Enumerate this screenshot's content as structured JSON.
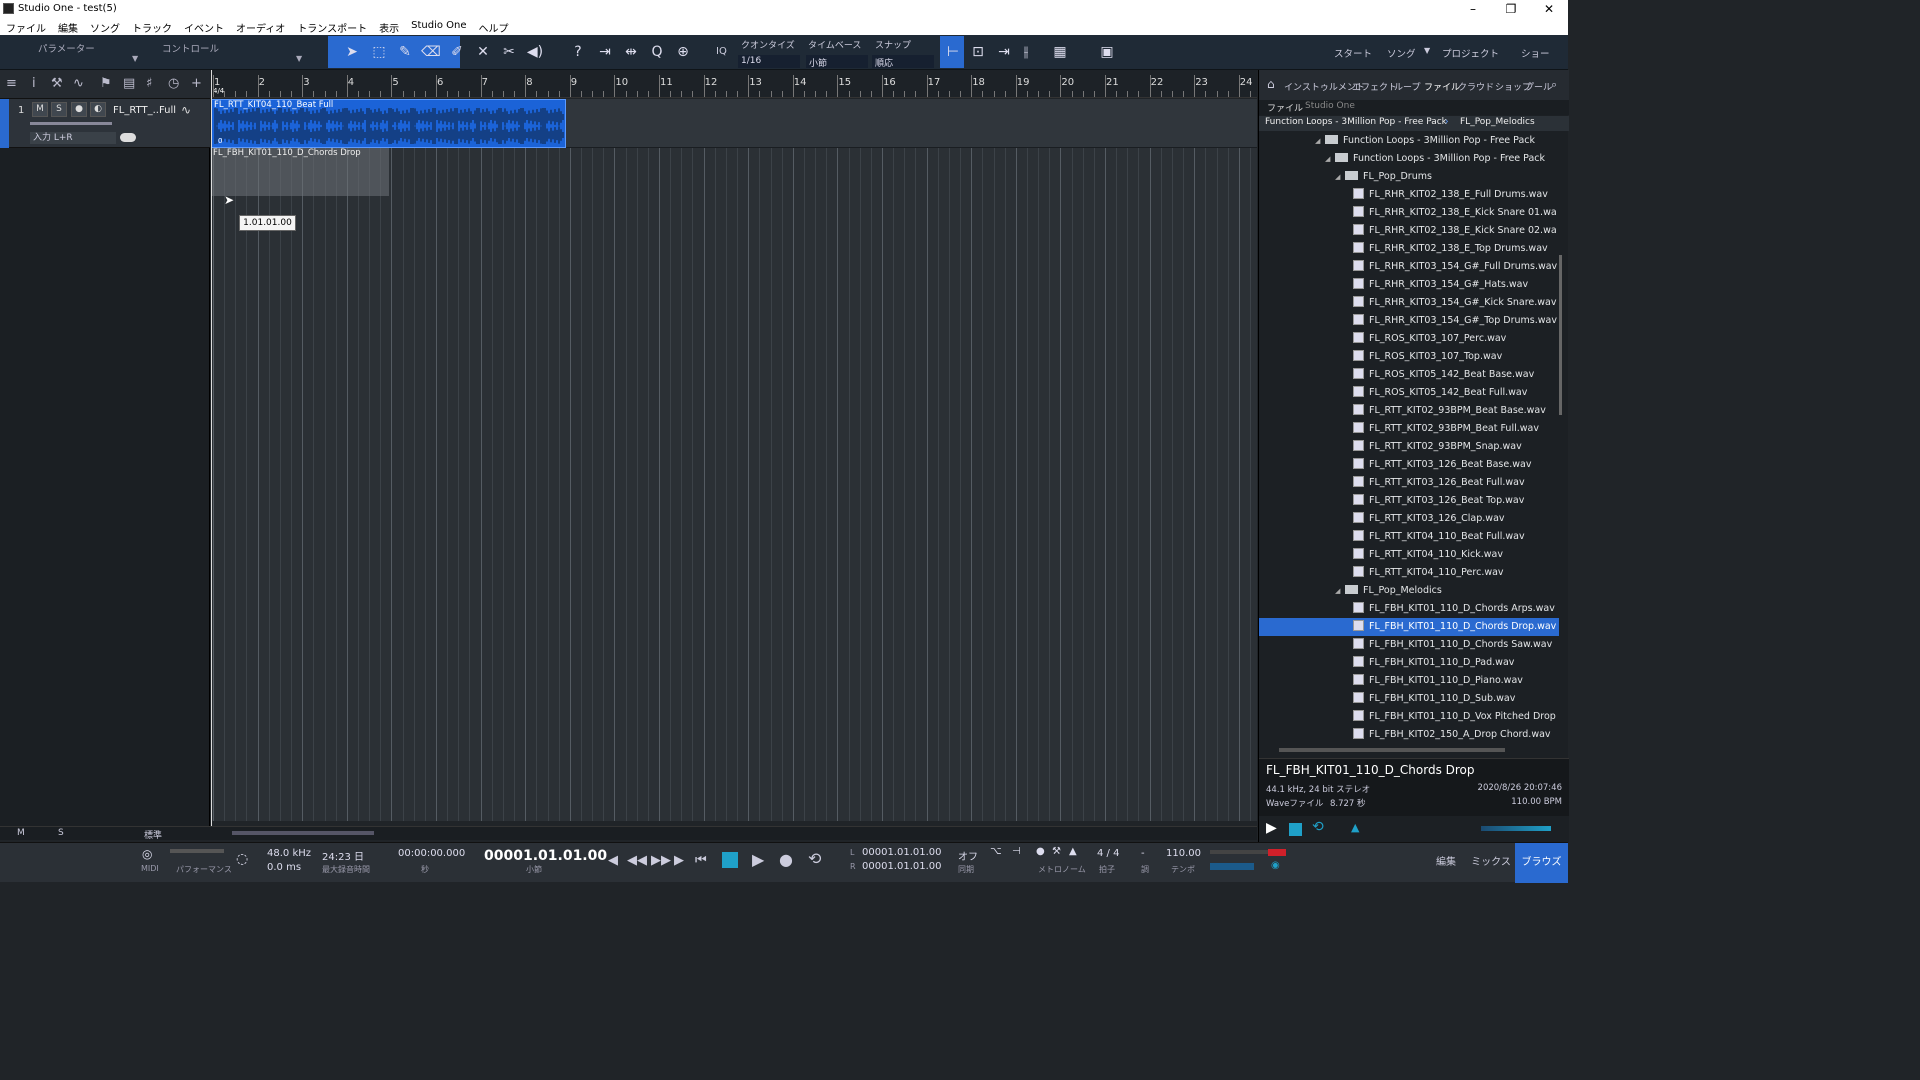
{
  "window": {
    "title": "Studio One - test(5)",
    "controls": [
      "–",
      "❐",
      "✕"
    ]
  },
  "menu": [
    "ファイル",
    "編集",
    "ソング",
    "トラック",
    "イベント",
    "オーディオ",
    "トランスポート",
    "表示",
    "Studio One",
    "ヘルプ"
  ],
  "toolbar": {
    "panel_tabs": [
      "パラメーター",
      "コントロール"
    ],
    "quantize": {
      "label": "クオンタイズ",
      "value": "1/16"
    },
    "timebase": {
      "label": "タイムベース",
      "value": "小節"
    },
    "snap": {
      "label": "スナップ",
      "value": "順応"
    },
    "iq_label": "IQ",
    "right_items": [
      "スタート",
      "ソング",
      "プロジェクト",
      "ショー"
    ]
  },
  "track": {
    "number": "1",
    "mute": "M",
    "solo": "S",
    "name": "FL_RTT_..Full",
    "input": "入力 L+R"
  },
  "ruler": {
    "bars": [
      "1",
      "2",
      "3",
      "4",
      "5",
      "6",
      "7",
      "8",
      "9",
      "10",
      "11",
      "12",
      "13",
      "14",
      "15",
      "16",
      "17",
      "18",
      "19",
      "20",
      "21",
      "22",
      "23",
      "24"
    ],
    "signature": "4/4"
  },
  "events": [
    {
      "name": "FL_RTT_KIT04_110_Beat Full",
      "edge_label": "0"
    },
    {
      "name": "FL_FBH_KIT01_110_D_Chords Drop"
    }
  ],
  "tooltip": "1.01.01.00",
  "bottom_strip": {
    "m": "M",
    "s": "S",
    "zoom_label": "標準"
  },
  "browser": {
    "tabs": [
      "インストゥルメント",
      "エフェクト",
      "ループ",
      "ファイル",
      "クラウド",
      "ショップ",
      "プール"
    ],
    "active_tab": "ファイル",
    "subtabs": [
      "ファイル",
      "Studio One"
    ],
    "breadcrumb": [
      "Function Loops - 3Million Pop - Free Pack",
      "FL_Pop_Melodics"
    ],
    "folders": [
      {
        "label": "Function Loops - 3Million Pop - Free Pack",
        "level": 0
      },
      {
        "label": "Function Loops - 3Million Pop - Free Pack",
        "level": 1
      },
      {
        "label": "FL_Pop_Drums",
        "level": 2
      }
    ],
    "drum_files": [
      "FL_RHR_KIT02_138_E_Full Drums.wav",
      "FL_RHR_KIT02_138_E_Kick Snare 01.wa",
      "FL_RHR_KIT02_138_E_Kick Snare 02.wa",
      "FL_RHR_KIT02_138_E_Top Drums.wav",
      "FL_RHR_KIT03_154_G#_Full Drums.wav",
      "FL_RHR_KIT03_154_G#_Hats.wav",
      "FL_RHR_KIT03_154_G#_Kick Snare.wav",
      "FL_RHR_KIT03_154_G#_Top Drums.wav",
      "FL_ROS_KIT03_107_Perc.wav",
      "FL_ROS_KIT03_107_Top.wav",
      "FL_ROS_KIT05_142_Beat Base.wav",
      "FL_ROS_KIT05_142_Beat Full.wav",
      "FL_RTT_KIT02_93BPM_Beat Base.wav",
      "FL_RTT_KIT02_93BPM_Beat Full.wav",
      "FL_RTT_KIT02_93BPM_Snap.wav",
      "FL_RTT_KIT03_126_Beat Base.wav",
      "FL_RTT_KIT03_126_Beat Full.wav",
      "FL_RTT_KIT03_126_Beat Top.wav",
      "FL_RTT_KIT03_126_Clap.wav",
      "FL_RTT_KIT04_110_Beat Full.wav",
      "FL_RTT_KIT04_110_Kick.wav",
      "FL_RTT_KIT04_110_Perc.wav"
    ],
    "melodic_folder": "FL_Pop_Melodics",
    "melodic_files": [
      "FL_FBH_KIT01_110_D_Chords Arps.wav",
      "FL_FBH_KIT01_110_D_Chords Drop.wav",
      "FL_FBH_KIT01_110_D_Chords Saw.wav",
      "FL_FBH_KIT01_110_D_Pad.wav",
      "FL_FBH_KIT01_110_D_Piano.wav",
      "FL_FBH_KIT01_110_D_Sub.wav",
      "FL_FBH_KIT01_110_D_Vox Pitched Drop",
      "FL_FBH_KIT02_150_A_Drop Chord.wav"
    ],
    "selected_file": "FL_FBH_KIT01_110_D_Chords Drop.wav",
    "info": {
      "name": "FL_FBH_KIT01_110_D_Chords Drop",
      "format": "44.1 kHz, 24 bit ステレオ",
      "date": "2020/8/26 20:07:46",
      "type": "Waveファイル",
      "length": "8.727 秒",
      "bpm": "110.00 BPM"
    }
  },
  "transport": {
    "midi": "MIDI",
    "performance": "パフォーマンス",
    "sample_rate": "48.0 kHz",
    "latency": "0.0 ms",
    "record_time": "24:23 日",
    "record_label": "最大録音時間",
    "seconds": "00:00:00.000",
    "seconds_label": "秒",
    "bars": "00001.01.01.00",
    "bars_label": "小節",
    "loop_l_label": "L",
    "loop_l": "00001.01.01.00",
    "loop_r_label": "R",
    "loop_r": "00001.01.01.00",
    "sync": "オフ",
    "sync_label": "同期",
    "metronome_label": "メトロノーム",
    "signature": "4 / 4",
    "signature_label": "拍子",
    "key": "-",
    "key_label": "調",
    "tempo": "110.00",
    "tempo_label": "テンポ",
    "pages": [
      "編集",
      "ミックス",
      "ブラウズ"
    ],
    "active_page": "ブラウズ"
  }
}
